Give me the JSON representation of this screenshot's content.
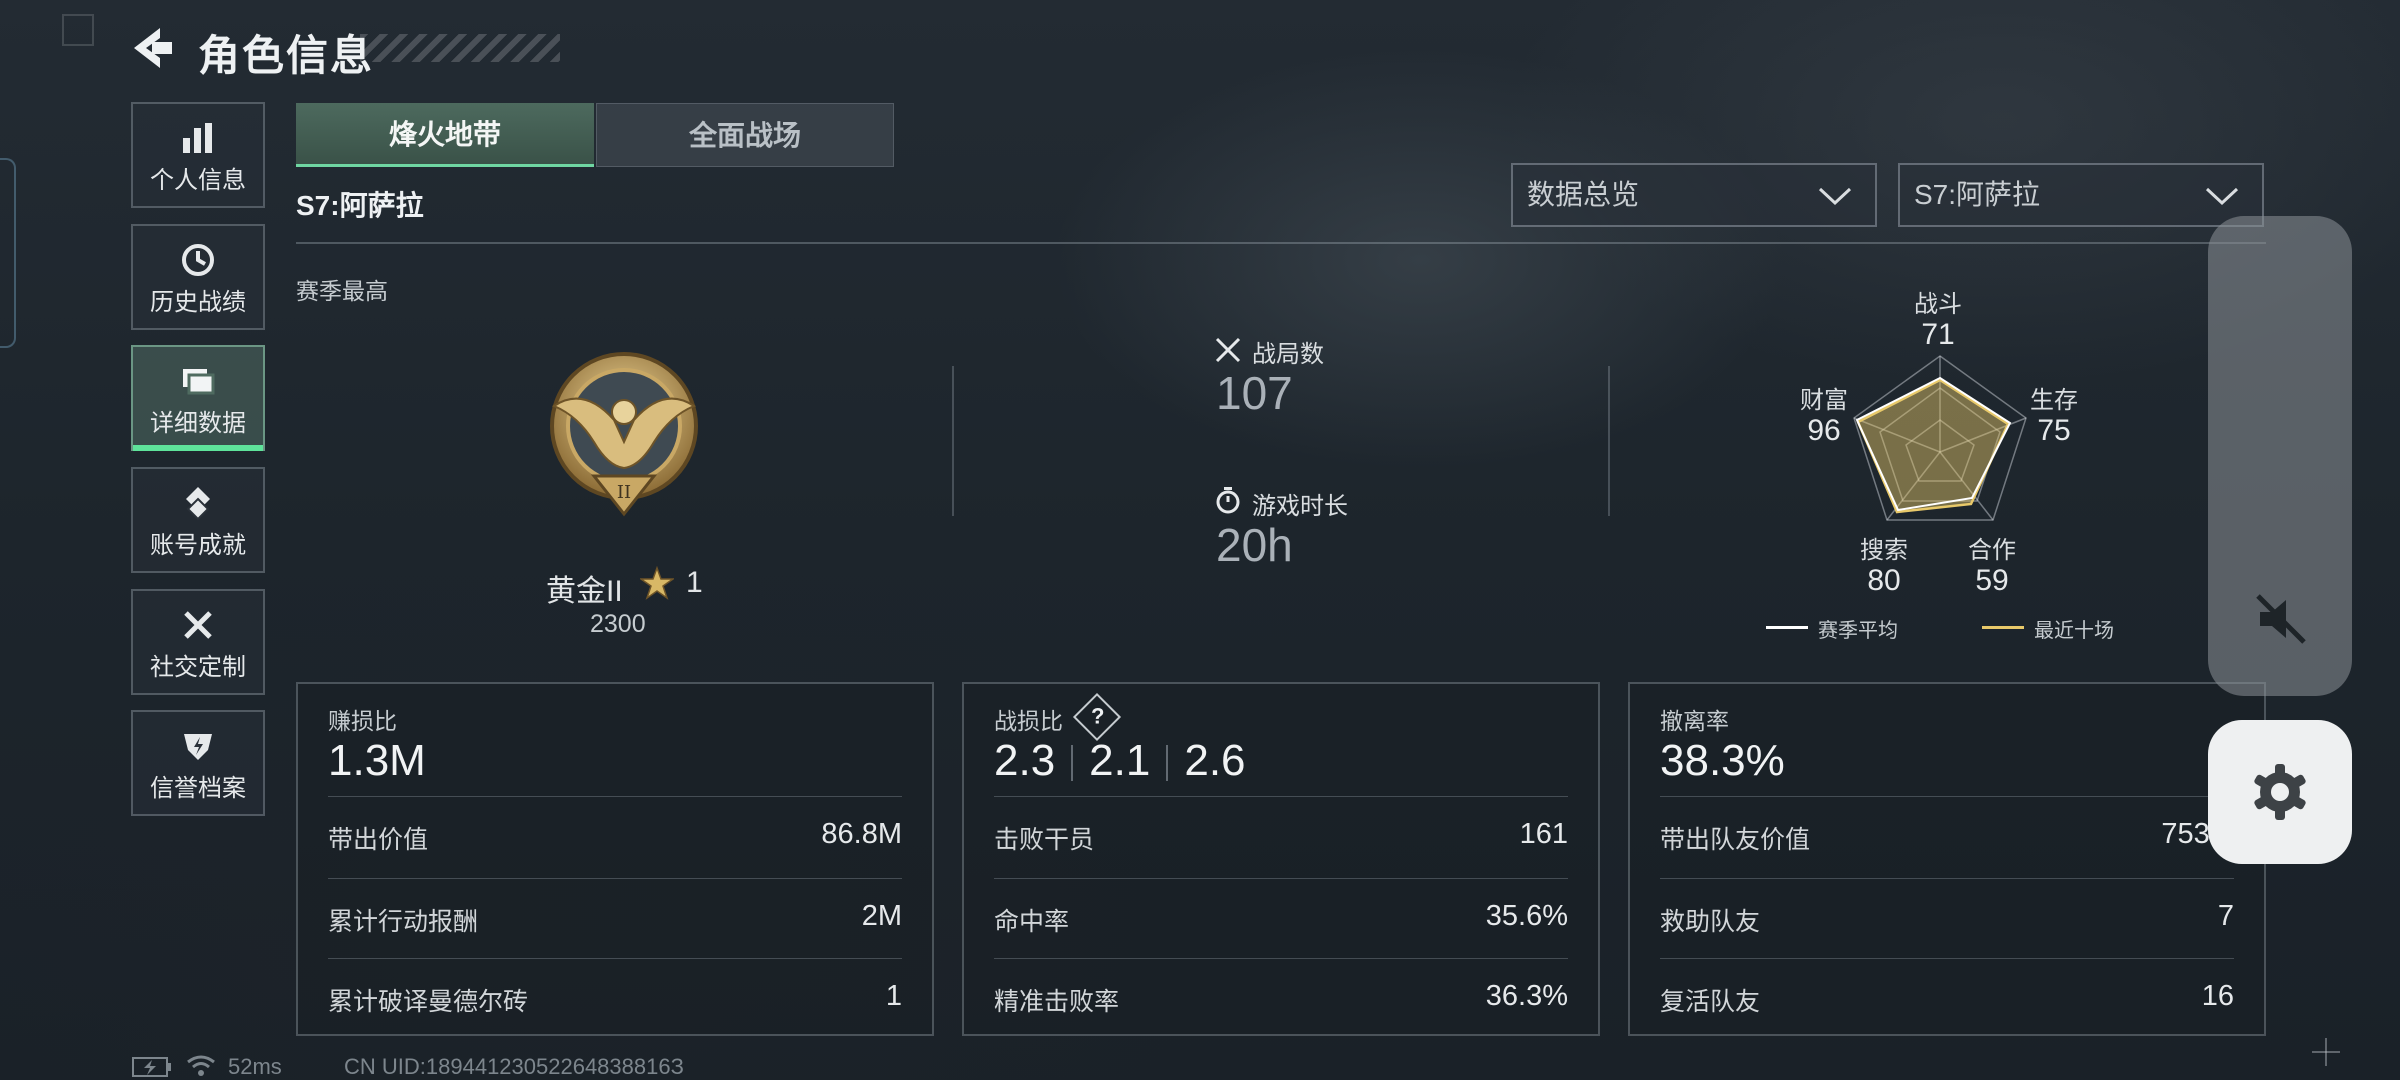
{
  "header": {
    "title": "角色信息"
  },
  "sidebar": {
    "items": [
      {
        "label": "个人信息",
        "icon": "bar-chart-icon"
      },
      {
        "label": "历史战绩",
        "icon": "history-icon"
      },
      {
        "label": "详细数据",
        "icon": "folders-icon"
      },
      {
        "label": "账号成就",
        "icon": "achievement-icon"
      },
      {
        "label": "社交定制",
        "icon": "tools-icon"
      },
      {
        "label": "信誉档案",
        "icon": "shield-icon"
      }
    ],
    "active": "详细数据"
  },
  "tabs": [
    {
      "label": "烽火地带",
      "active": true
    },
    {
      "label": "全面战场",
      "active": false
    }
  ],
  "season": "S7:阿萨拉",
  "dropdowns": {
    "overview": "数据总览",
    "season": "S7:阿萨拉"
  },
  "season_best": {
    "label": "赛季最高",
    "rank": "黄金II",
    "stars": "1",
    "score": "2300"
  },
  "summary": {
    "matches_label": "战局数",
    "matches": "107",
    "playtime_label": "游戏时长",
    "playtime": "20h"
  },
  "radar": {
    "axes": [
      {
        "label": "战斗",
        "value": "71"
      },
      {
        "label": "生存",
        "value": "75"
      },
      {
        "label": "合作",
        "value": "59"
      },
      {
        "label": "搜索",
        "value": "80"
      },
      {
        "label": "财富",
        "value": "96"
      }
    ],
    "legend": {
      "season_avg": "赛季平均",
      "recent": "最近十场"
    },
    "colors": {
      "season_avg": "#ffffff",
      "recent": "#e8c96a"
    }
  },
  "cards": {
    "profit": {
      "title": "赚损比",
      "value": "1.3M",
      "rows": [
        {
          "label": "带出价值",
          "value": "86.8M"
        },
        {
          "label": "累计行动报酬",
          "value": "2M"
        },
        {
          "label": "累计破译曼德尔砖",
          "value": "1"
        }
      ]
    },
    "kd": {
      "title": "战损比",
      "help": "?",
      "values": [
        "2.3",
        "2.1",
        "2.6"
      ],
      "rows": [
        {
          "label": "击败干员",
          "value": "161"
        },
        {
          "label": "命中率",
          "value": "35.6%"
        },
        {
          "label": "精准击败率",
          "value": "36.3%"
        }
      ]
    },
    "extract": {
      "title": "撤离率",
      "value": "38.3%",
      "rows": [
        {
          "label": "带出队友价值",
          "value": "753.3"
        },
        {
          "label": "救助队友",
          "value": "7"
        },
        {
          "label": "复活队友",
          "value": "16"
        }
      ]
    }
  },
  "footer": {
    "ping": "52ms",
    "uid": "CN UID:18944123052264838816З"
  }
}
